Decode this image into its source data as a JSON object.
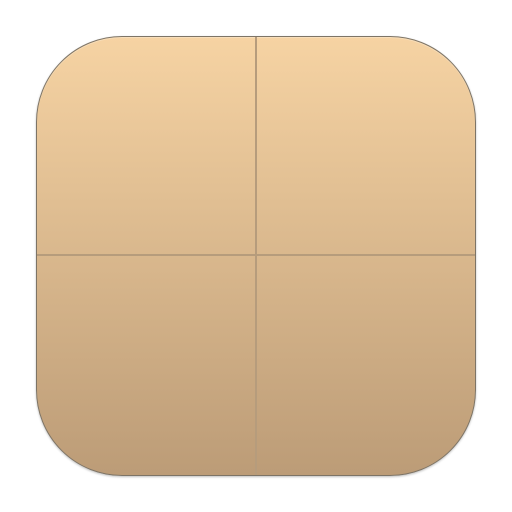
{
  "icon": {
    "name": "grid-layout-icon",
    "colors": {
      "top": "#f6d3a3",
      "bottom": "#bc9c77",
      "border": "#7d7466",
      "divider": "#b69c7c"
    },
    "quadrants": [
      "top-left",
      "top-right",
      "bottom-left",
      "bottom-right"
    ]
  }
}
